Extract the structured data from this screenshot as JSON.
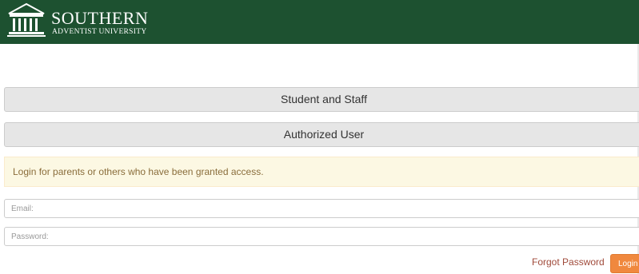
{
  "header": {
    "logo_name": "SOUTHERN",
    "logo_subtitle": "ADVENTIST UNIVERSITY",
    "logo_icon": "columned-building-icon",
    "background_color": "#1d5130"
  },
  "login_options": {
    "student_staff_label": "Student and Staff",
    "authorized_user_label": "Authorized User"
  },
  "alert": {
    "message": "Login for parents or others who have been granted access."
  },
  "form": {
    "email_placeholder": "Email:",
    "password_placeholder": "Password:",
    "forgot_password_label": "Forgot Password",
    "login_label": "Login",
    "login_color": "#f0883e"
  }
}
